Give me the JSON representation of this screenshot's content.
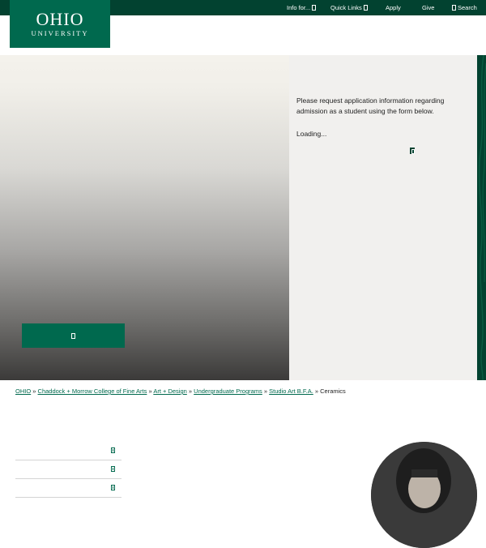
{
  "header": {
    "logo": {
      "line1": "OHIO",
      "line2": "UNIVERSITY"
    },
    "nav": {
      "info_for": "Info for...",
      "quick_links": "Quick Links",
      "apply": "Apply",
      "give": "Give",
      "search": "Search"
    }
  },
  "hero": {
    "button_label": ""
  },
  "form": {
    "intro": "Please request application information regarding admission as a student using the form below.",
    "loading": "Loading..."
  },
  "breadcrumb": {
    "items": [
      "OHIO",
      "Chaddock + Morrow College of Fine Arts",
      "Art + Design",
      "Undergraduate Programs",
      "Studio Art B.F.A."
    ],
    "current": "Ceramics",
    "separator": "»"
  },
  "colors": {
    "brand_dark": "#024230",
    "brand_green": "#00694e",
    "panel_bg": "#f1f0ee"
  }
}
